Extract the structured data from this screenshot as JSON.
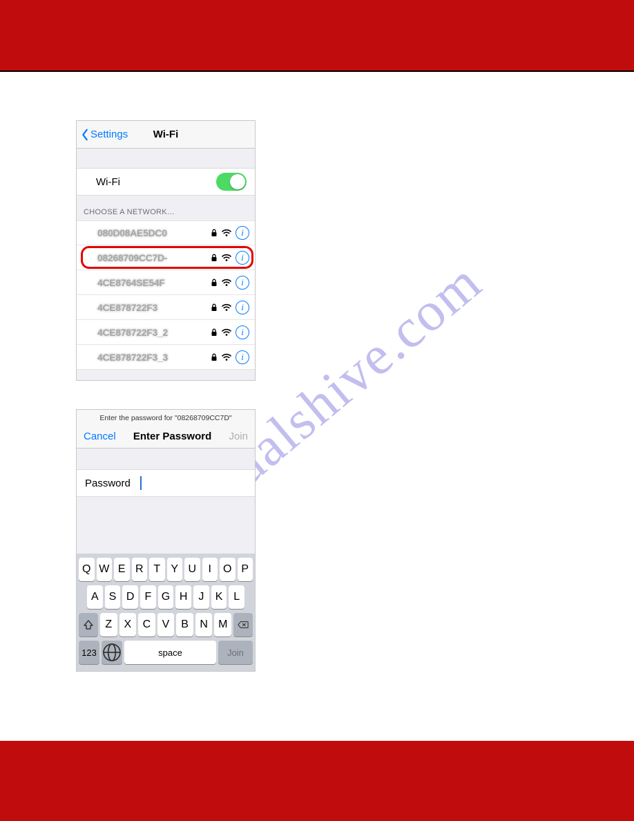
{
  "watermark": "manualshive.com",
  "wifi_screen": {
    "back_label": "Settings",
    "title": "Wi-Fi",
    "toggle_label": "Wi-Fi",
    "toggle_on": true,
    "group_header": "CHOOSE A NETWORK…",
    "networks": [
      {
        "ssid": "080D08AE5DC0",
        "secured": true,
        "highlighted": false
      },
      {
        "ssid": "08268709CC7D-",
        "secured": true,
        "highlighted": true
      },
      {
        "ssid": "4CE8764SE54F",
        "secured": true,
        "highlighted": false
      },
      {
        "ssid": "4CE878722F3",
        "secured": true,
        "highlighted": false
      },
      {
        "ssid": "4CE878722F3_2",
        "secured": true,
        "highlighted": false
      },
      {
        "ssid": "4CE878722F3_3",
        "secured": true,
        "highlighted": false
      }
    ]
  },
  "pw_screen": {
    "prompt_prefix": "Enter the password for \"",
    "prompt_ssid": "08268709CC7D",
    "prompt_suffix": "\"",
    "cancel": "Cancel",
    "title": "Enter Password",
    "join": "Join",
    "field_label": "Password"
  },
  "keyboard": {
    "row1": [
      "Q",
      "W",
      "E",
      "R",
      "T",
      "Y",
      "U",
      "I",
      "O",
      "P"
    ],
    "row2": [
      "A",
      "S",
      "D",
      "F",
      "G",
      "H",
      "J",
      "K",
      "L"
    ],
    "row3": [
      "Z",
      "X",
      "C",
      "V",
      "B",
      "N",
      "M"
    ],
    "num": "123",
    "space": "space",
    "join": "Join"
  }
}
